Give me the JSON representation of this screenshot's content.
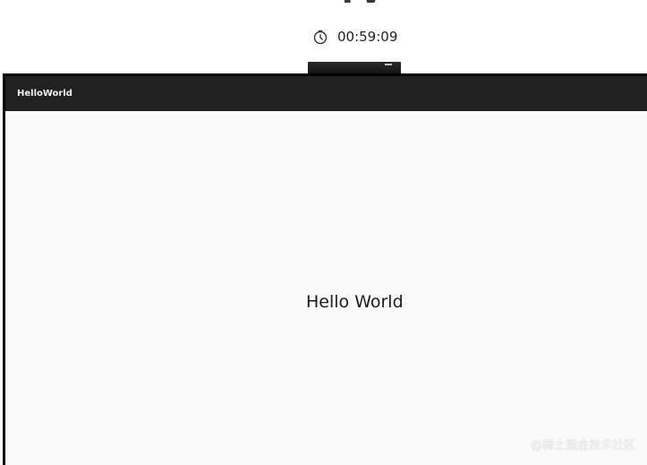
{
  "top": {
    "title_fragment": "TV",
    "timer_icon": "timer-icon",
    "timer_value": "00:59:09"
  },
  "app": {
    "title": "HelloWorld",
    "content_text": "Hello World"
  },
  "watermark": "@稀土掘金技术社区",
  "colors": {
    "app_bar": "#212121",
    "content_bg": "#fafafa",
    "frame": "#000000"
  }
}
